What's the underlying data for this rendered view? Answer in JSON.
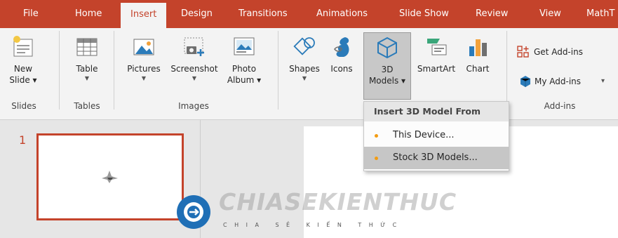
{
  "tabs": [
    "File",
    "Home",
    "Insert",
    "Design",
    "Transitions",
    "Animations",
    "Slide Show",
    "Review",
    "View",
    "MathT"
  ],
  "ribbon": {
    "new_slide": {
      "line1": "New",
      "line2": "Slide"
    },
    "table": "Table",
    "pictures": "Pictures",
    "screenshot": "Screenshot",
    "photo_album": {
      "line1": "Photo",
      "line2": "Album"
    },
    "shapes": "Shapes",
    "icons": "Icons",
    "models_3d": {
      "line1": "3D",
      "line2": "Models"
    },
    "smartart": "SmartArt",
    "chart": "Chart",
    "get_addins": "Get Add-ins",
    "my_addins": "My Add-ins",
    "groups": {
      "slides": "Slides",
      "tables": "Tables",
      "images": "Images",
      "addins": "Add-ins"
    }
  },
  "thumbnail": {
    "slide_number": "1"
  },
  "dropdown": {
    "header": "Insert 3D Model From",
    "items": [
      {
        "label": "This Device...",
        "hovered": false
      },
      {
        "label": "Stock 3D Models...",
        "hovered": true
      }
    ],
    "bullet_color": "#f39c12"
  },
  "watermark": {
    "brand": "CHIASEKIENTHUC",
    "tagline": "CHIA SẺ KIẾN THỨC"
  },
  "colors": {
    "accent": "#c4432b",
    "ribbon_bg": "#f3f3f3"
  }
}
